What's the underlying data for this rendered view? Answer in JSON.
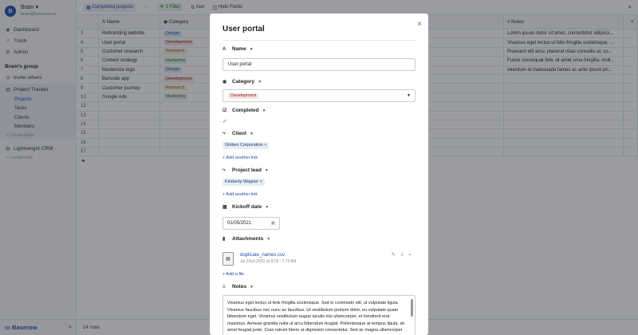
{
  "user": {
    "initial": "B",
    "name": "Bram ▾",
    "email": "bram@baserow.io"
  },
  "sidebar": {
    "items": [
      {
        "label": "Dashboard",
        "icon": "dashboard-icon",
        "glyph": "◉"
      },
      {
        "label": "Trash",
        "icon": "trash-icon",
        "glyph": "🗑"
      },
      {
        "label": "Admin",
        "icon": "admin-icon",
        "glyph": "⚙"
      }
    ],
    "group_title": "Bram's group",
    "invite": "Invite others",
    "database": "Project Tracker",
    "tables": [
      "Projects",
      "Tasks",
      "Clients",
      "Members"
    ],
    "create_table": "+ Create table",
    "database2": "Lightweight CRM",
    "create_new": "+ Create new",
    "logo": "Baserow",
    "collapse": "«"
  },
  "toolbar": {
    "view": "Completed projects",
    "more": "···",
    "filter": "1 Filter",
    "sort": "Sort",
    "hide": "Hide Fields"
  },
  "grid": {
    "headers": {
      "name": "Name",
      "category": "Category",
      "notes": "Notes",
      "add": "+"
    },
    "rows": [
      {
        "num": "3",
        "name": "Rebranding website",
        "category": "Design",
        "cat": "design",
        "notes": "Lorem ipsum dolor sit amet, consectetur adipisci..."
      },
      {
        "num": "4",
        "name": "User portal",
        "category": "Development",
        "cat": "development",
        "notes": "Vivamus eget lectus ut felis fringilla scelerisque. ..."
      },
      {
        "num": "5",
        "name": "Customer research",
        "category": "Research",
        "cat": "research",
        "notes": "Praesent elit arcu, placerat vitae convallis at, co..."
      },
      {
        "num": "6",
        "name": "Content strategy",
        "category": "Marketing",
        "cat": "marketing",
        "notes": "Fusce consequat felis sit amet urna fringilla, moll..."
      },
      {
        "num": "7",
        "name": "Modernize logo",
        "category": "Design",
        "cat": "design",
        "notes": "Interdum et malesuada fames ac ante ipsum pri..."
      },
      {
        "num": "8",
        "name": "Barcode app",
        "category": "Development",
        "cat": "development",
        "notes": ""
      },
      {
        "num": "9",
        "name": "Customer journey",
        "category": "Research",
        "cat": "research",
        "notes": ""
      },
      {
        "num": "10",
        "name": "Google Ads",
        "category": "Marketing",
        "cat": "marketing",
        "notes": ""
      },
      {
        "num": "12",
        "name": "",
        "category": "",
        "cat": "",
        "notes": ""
      },
      {
        "num": "13",
        "name": "",
        "category": "",
        "cat": "",
        "notes": ""
      },
      {
        "num": "14",
        "name": "",
        "category": "",
        "cat": "",
        "notes": ""
      },
      {
        "num": "15",
        "name": "",
        "category": "",
        "cat": "",
        "notes": ""
      },
      {
        "num": "16",
        "name": "",
        "category": "",
        "cat": "",
        "notes": ""
      },
      {
        "num": "17",
        "name": "",
        "category": "",
        "cat": "",
        "notes": ""
      }
    ],
    "add_row": "+",
    "row_count": "14 rows"
  },
  "modal": {
    "title": "User portal",
    "close": "×",
    "name_label": "Name",
    "name_value": "User portal",
    "category_label": "Category",
    "category_value": "Development",
    "completed_label": "Completed",
    "completed_check": "✓",
    "client_label": "Client",
    "client_chip": "Globex Corporation ×",
    "client_add": "+ Add another link",
    "lead_label": "Project lead",
    "lead_chip": "Kimberly Wagner ×",
    "lead_add": "+ Add another link",
    "kickoff_label": "Kickoff date",
    "kickoff_value": "01/05/2021",
    "attachments_label": "Attachments",
    "file_name": "duplicate_names.csv",
    "file_meta": "Jul 22nd 2021 at 9:15 - 7.73 KB",
    "add_file": "+ Add a file",
    "notes_label": "Notes",
    "notes_text": "Vivamus eget lectus ut felis fringilla scelerisque. Sed in commodo elit, ut vulputate ligula. Vivamus faucibus nec nunc ac faucibus. Ut vestibulum pretium dolor, eu vulputate quam bibendum eget. Vivamus vestibulum augue iaculis nisi ullamcorper, et hendrerit erat maximus. Aenean gravida nulla ut arcu bibendum feugiat. Pellentesque at tempus ligula, sit amet feugiat justo. Cras rutrum libero at dignissim consectetur. Sed ac magna ullamcorper"
  }
}
